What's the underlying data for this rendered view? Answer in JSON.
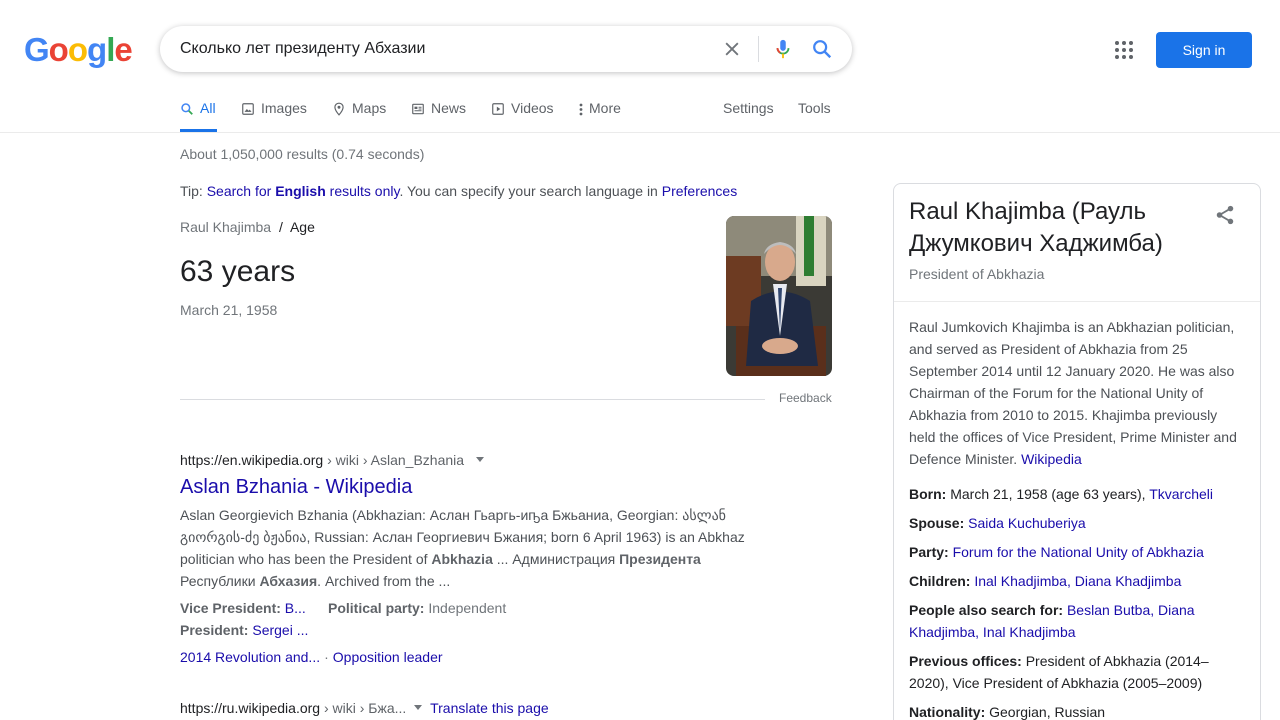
{
  "colors": {
    "accent": "#1a73e8",
    "link": "#1a0dab",
    "logo_blue": "#4285f4",
    "logo_red": "#ea4335",
    "logo_yellow": "#fbbc05",
    "logo_green": "#34a853"
  },
  "header": {
    "logo_letters": [
      "G",
      "o",
      "o",
      "g",
      "l",
      "e"
    ],
    "search_value": "Сколько лет президенту Абхазии",
    "signin_label": "Sign in",
    "icons": [
      "close-icon",
      "mic-icon",
      "search-icon",
      "apps-icon"
    ]
  },
  "tabs": [
    {
      "label": "All",
      "icon": "search-icon"
    },
    {
      "label": "Images",
      "icon": "image-icon"
    },
    {
      "label": "Maps",
      "icon": "map-pin-icon"
    },
    {
      "label": "News",
      "icon": "news-icon"
    },
    {
      "label": "Videos",
      "icon": "video-icon"
    },
    {
      "label": "More",
      "icon": "more-dots-icon"
    },
    {
      "label": "Settings"
    },
    {
      "label": "Tools"
    }
  ],
  "results": {
    "stats": "About 1,050,000 results (0.74 seconds)",
    "tip": {
      "prefix": "Tip: ",
      "link1": "Search for ",
      "bold": "English",
      "link1_suffix": " results only",
      "middle": ". You can specify your search language in ",
      "link2": "Preferences"
    },
    "answer": {
      "crumb_entity": "Raul Khajimba",
      "crumb_sep": "/",
      "crumb_attr": "Age",
      "value": "63 years",
      "date": "March 21, 1958",
      "feedback": "Feedback"
    },
    "r1": {
      "site": "https://en.wikipedia.org",
      "path": " › wiki › Aslan_Bzhania",
      "title": "Aslan Bzhania - Wikipedia",
      "snippet": [
        {
          "t": "Aslan Georgievich Bzhania (Abkhazian: Аслан Гьаргь-иҧа Бжьаниа, Georgian: ასლან გიორგის-ძე ბჟანია, Russian: Аслан Георгиевич Бжания; born 6 April 1963) is an Abkhaz politician who has been the President of ",
          "b": false
        },
        {
          "t": "Abkhazia",
          "b": true
        },
        {
          "t": " ... Администрация ",
          "b": false
        },
        {
          "t": "Президента",
          "b": true
        },
        {
          "t": " Республики ",
          "b": false
        },
        {
          "t": "Абхазия",
          "b": true
        },
        {
          "t": ". Archived from the ...",
          "b": false
        }
      ],
      "vp_label": "Vice President:",
      "vp_value": "B...",
      "party_label": "Political party:",
      "party_value": "Independent",
      "pres_label": "President:",
      "pres_value": "Sergei ...",
      "sitelink1": "2014 Revolution and...",
      "sitelink_sep": "·",
      "sitelink2": "Opposition leader"
    },
    "r2": {
      "site": "https://ru.wikipedia.org",
      "path": " › wiki › Бжа...",
      "translate": "Translate this page"
    }
  },
  "knowledge_panel": {
    "title": "Raul Khajimba (Рауль Джумкович Хаджимба)",
    "subtitle": "President of Abkhazia",
    "description": "Raul Jumkovich Khajimba is an Abkhazian politician, and served as President of Abkhazia from 25 September 2014 until 12 January 2020. He was also Chairman of the Forum for the National Unity of Abkhazia from 2010 to 2015. Khajimba previously held the offices of Vice President, Prime Minister and Defence Minister.",
    "desc_link": "Wikipedia",
    "facts": {
      "born_label": "Born:",
      "born_value": "March 21, 1958 (age 63 years),",
      "born_link": "Tkvarcheli",
      "spouse_label": "Spouse:",
      "spouse_link": "Saida Kuchuberiya",
      "party_label": "Party:",
      "party_link": "Forum for the National Unity of Abkhazia",
      "children_label": "Children:",
      "children_link": "Inal Khadjimba, Diana Khadjimba",
      "pas_label": "People also search for:",
      "pas_link": "Beslan Butba, Diana Khadjimba, Inal Khadjimba",
      "prev_label": "Previous offices:",
      "prev_value": "President of Abkhazia (2014–2020), Vice President of Abkhazia (2005–2009)",
      "nat_label": "Nationality:",
      "nat_value": "Georgian, Russian"
    }
  }
}
